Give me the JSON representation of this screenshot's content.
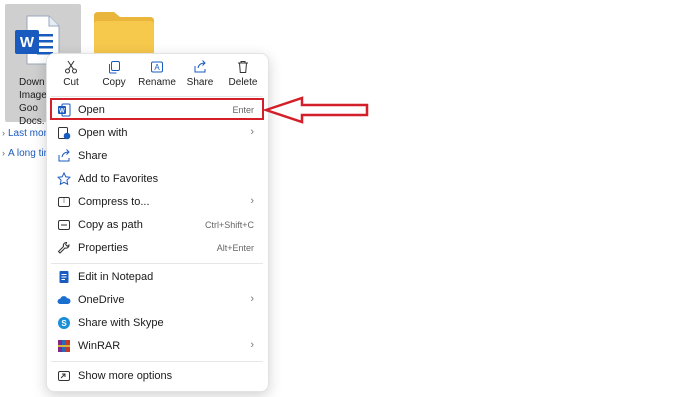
{
  "file": {
    "name_lines": [
      "Down",
      "Images",
      "Goo",
      "Docs."
    ]
  },
  "groups": [
    {
      "label": "Last mon"
    },
    {
      "label": "A long tin"
    }
  ],
  "toolbar": [
    {
      "label": "Cut",
      "icon": "scissors-icon"
    },
    {
      "label": "Copy",
      "icon": "copy-icon"
    },
    {
      "label": "Rename",
      "icon": "rename-icon"
    },
    {
      "label": "Share",
      "icon": "share-icon"
    },
    {
      "label": "Delete",
      "icon": "trash-icon"
    }
  ],
  "menu": [
    {
      "label": "Open",
      "shortcut": "Enter",
      "icon": "word-icon"
    },
    {
      "label": "Open with",
      "icon": "open-with-icon",
      "submenu": true
    },
    {
      "label": "Share",
      "icon": "share-icon"
    },
    {
      "label": "Add to Favorites",
      "icon": "star-icon"
    },
    {
      "label": "Compress to...",
      "icon": "zip-icon",
      "submenu": true
    },
    {
      "label": "Copy as path",
      "shortcut": "Ctrl+Shift+C",
      "icon": "path-icon"
    },
    {
      "label": "Properties",
      "shortcut": "Alt+Enter",
      "icon": "wrench-icon"
    },
    {
      "label": "Edit in Notepad",
      "icon": "notepad-icon"
    },
    {
      "label": "OneDrive",
      "icon": "cloud-icon",
      "submenu": true
    },
    {
      "label": "Share with Skype",
      "icon": "skype-icon"
    },
    {
      "label": "WinRAR",
      "icon": "winrar-icon",
      "submenu": true
    },
    {
      "label": "Show more options",
      "icon": "more-options-icon"
    }
  ],
  "colors": {
    "highlight": "#d21f2a",
    "word_blue": "#185abd",
    "folder": "#f6c84c"
  }
}
